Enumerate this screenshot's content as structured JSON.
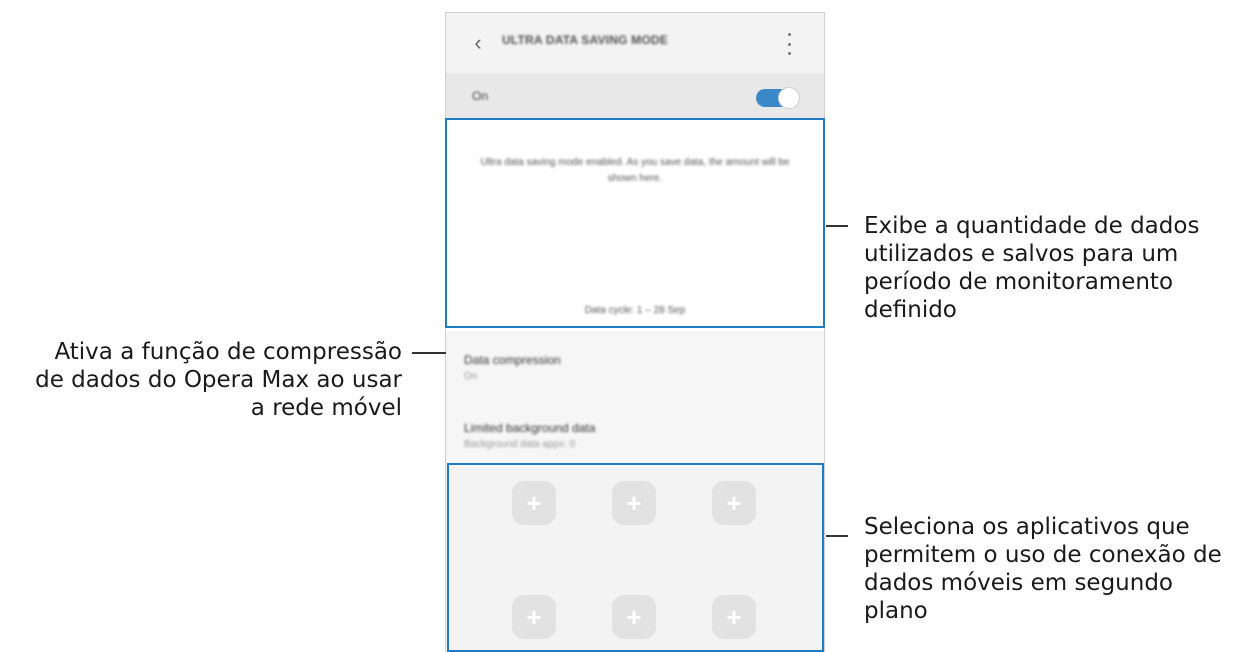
{
  "app": {
    "title": "ULTRA DATA SAVING MODE",
    "back_icon": "chevron-left-icon",
    "more_icon": "more-vertical-icon"
  },
  "master_switch": {
    "label": "On",
    "state": "on",
    "accent_color": "#3b88c8"
  },
  "info_card": {
    "description": "Ultra data saving mode enabled. As you save data, the amount will be shown here.",
    "cycle": "Data cycle: 1 – 28 Sep"
  },
  "settings": [
    {
      "title": "Data compression",
      "subtitle": "On"
    },
    {
      "title": "Limited background data",
      "subtitle": "Background data apps: 0"
    }
  ],
  "apps_grid": {
    "slots": [
      "+",
      "+",
      "+",
      "+",
      "+",
      "+"
    ],
    "slot_icon": "plus-icon"
  },
  "callouts": {
    "data_usage": [
      "Exibe a quantidade de dados",
      "utilizados e salvos para um",
      "período de monitoramento",
      "definido"
    ],
    "compression": [
      "Ativa a função de compressão",
      "de dados do Opera Max ao usar",
      "a rede móvel"
    ],
    "background_apps": [
      "Seleciona os aplicativos que",
      "permitem o uso de conexão de",
      "dados móveis em segundo",
      "plano"
    ]
  },
  "colors": {
    "highlight": "#1f7cc3",
    "leader": "#333333"
  }
}
